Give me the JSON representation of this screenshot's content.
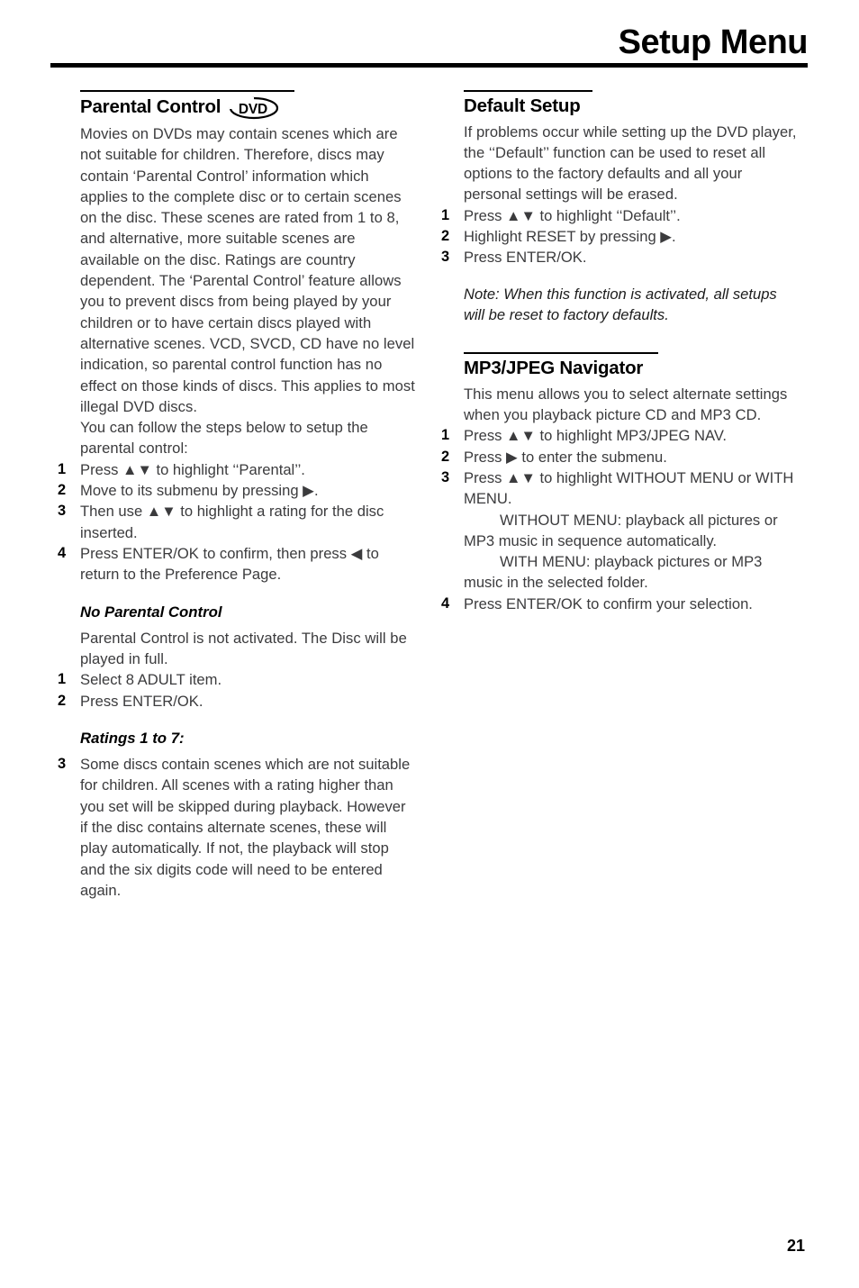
{
  "header": {
    "title": "Setup Menu"
  },
  "footer": {
    "page_number": "21"
  },
  "icons": {
    "dvd_badge_label": "DVD"
  },
  "left_column": {
    "parental_control": {
      "heading": "Parental Control",
      "intro": "Movies on DVDs may contain scenes which are not suitable for children. Therefore, discs may contain ‘Parental Control’ information which applies to the complete disc or to certain scenes on the disc. These scenes are rated from 1 to 8, and alternative, more suitable scenes are available on the disc. Ratings are country dependent. The ‘Parental Control’ feature allows you to prevent discs from being played by your children or to have certain discs played with alternative scenes. VCD, SVCD, CD have no level indication, so parental control function has no effect on those kinds of discs. This applies to most illegal DVD discs.",
      "intro2": "You can follow the steps below to setup the parental control:",
      "steps": [
        {
          "num": "1",
          "text": "Press ▲▼ to highlight ‘‘Parental’’."
        },
        {
          "num": "2",
          "text": "Move to its submenu by pressing ▶."
        },
        {
          "num": "3",
          "text": "Then use ▲▼ to highlight a rating for the disc inserted."
        },
        {
          "num": "4",
          "text": "Press ENTER/OK to confirm, then press ◀ to return to the Preference Page."
        }
      ]
    },
    "no_parental_control": {
      "subheading": "No Parental Control",
      "body": "Parental Control is not activated. The Disc will be played in full.",
      "steps": [
        {
          "num": "1",
          "text": "Select 8 ADULT item."
        },
        {
          "num": "2",
          "text": "Press ENTER/OK."
        }
      ]
    },
    "ratings": {
      "subheading": "Ratings 1 to 7:",
      "steps": [
        {
          "num": "3",
          "text": "Some discs contain scenes which are not suitable for children. All scenes with a rating higher than you set will be skipped during playback. However if the disc contains alternate scenes, these will play automatically. If not, the playback will stop and the six digits code will need to be entered again."
        }
      ]
    }
  },
  "right_column": {
    "default_setup": {
      "heading": "Default Setup",
      "intro": "If problems occur while setting up the DVD player, the ‘‘Default’’ function can be used to reset all options to the factory defaults and all your personal settings will be erased.",
      "steps": [
        {
          "num": "1",
          "text": "Press ▲▼ to highlight ‘‘Default’’."
        },
        {
          "num": "2",
          "text": "Highlight RESET by pressing ▶."
        },
        {
          "num": "3",
          "text": "Press ENTER/OK."
        }
      ],
      "note": "Note: When this function is activated, all setups will be reset to factory defaults."
    },
    "mp3_jpeg_navigator": {
      "heading": "MP3/JPEG Navigator",
      "intro": "This menu allows you to select alternate settings when you playback picture CD and MP3 CD.",
      "steps": [
        {
          "num": "1",
          "text": "Press ▲▼ to highlight MP3/JPEG NAV."
        },
        {
          "num": "2",
          "text": "Press ▶ to enter the submenu."
        },
        {
          "num": "3",
          "text": "Press ▲▼ to highlight WITHOUT MENU or WITH MENU."
        },
        {
          "num": "4",
          "text": "Press ENTER/OK to confirm your selection."
        }
      ],
      "step3_detail_a": "WITHOUT MENU: playback all pictures or MP3 music in sequence automatically.",
      "step3_detail_b": "WITH MENU: playback pictures or MP3 music in the selected folder."
    }
  },
  "colors": {
    "ink": "#231f20",
    "body_text": "#3b3b3d",
    "rule": "#000000"
  }
}
